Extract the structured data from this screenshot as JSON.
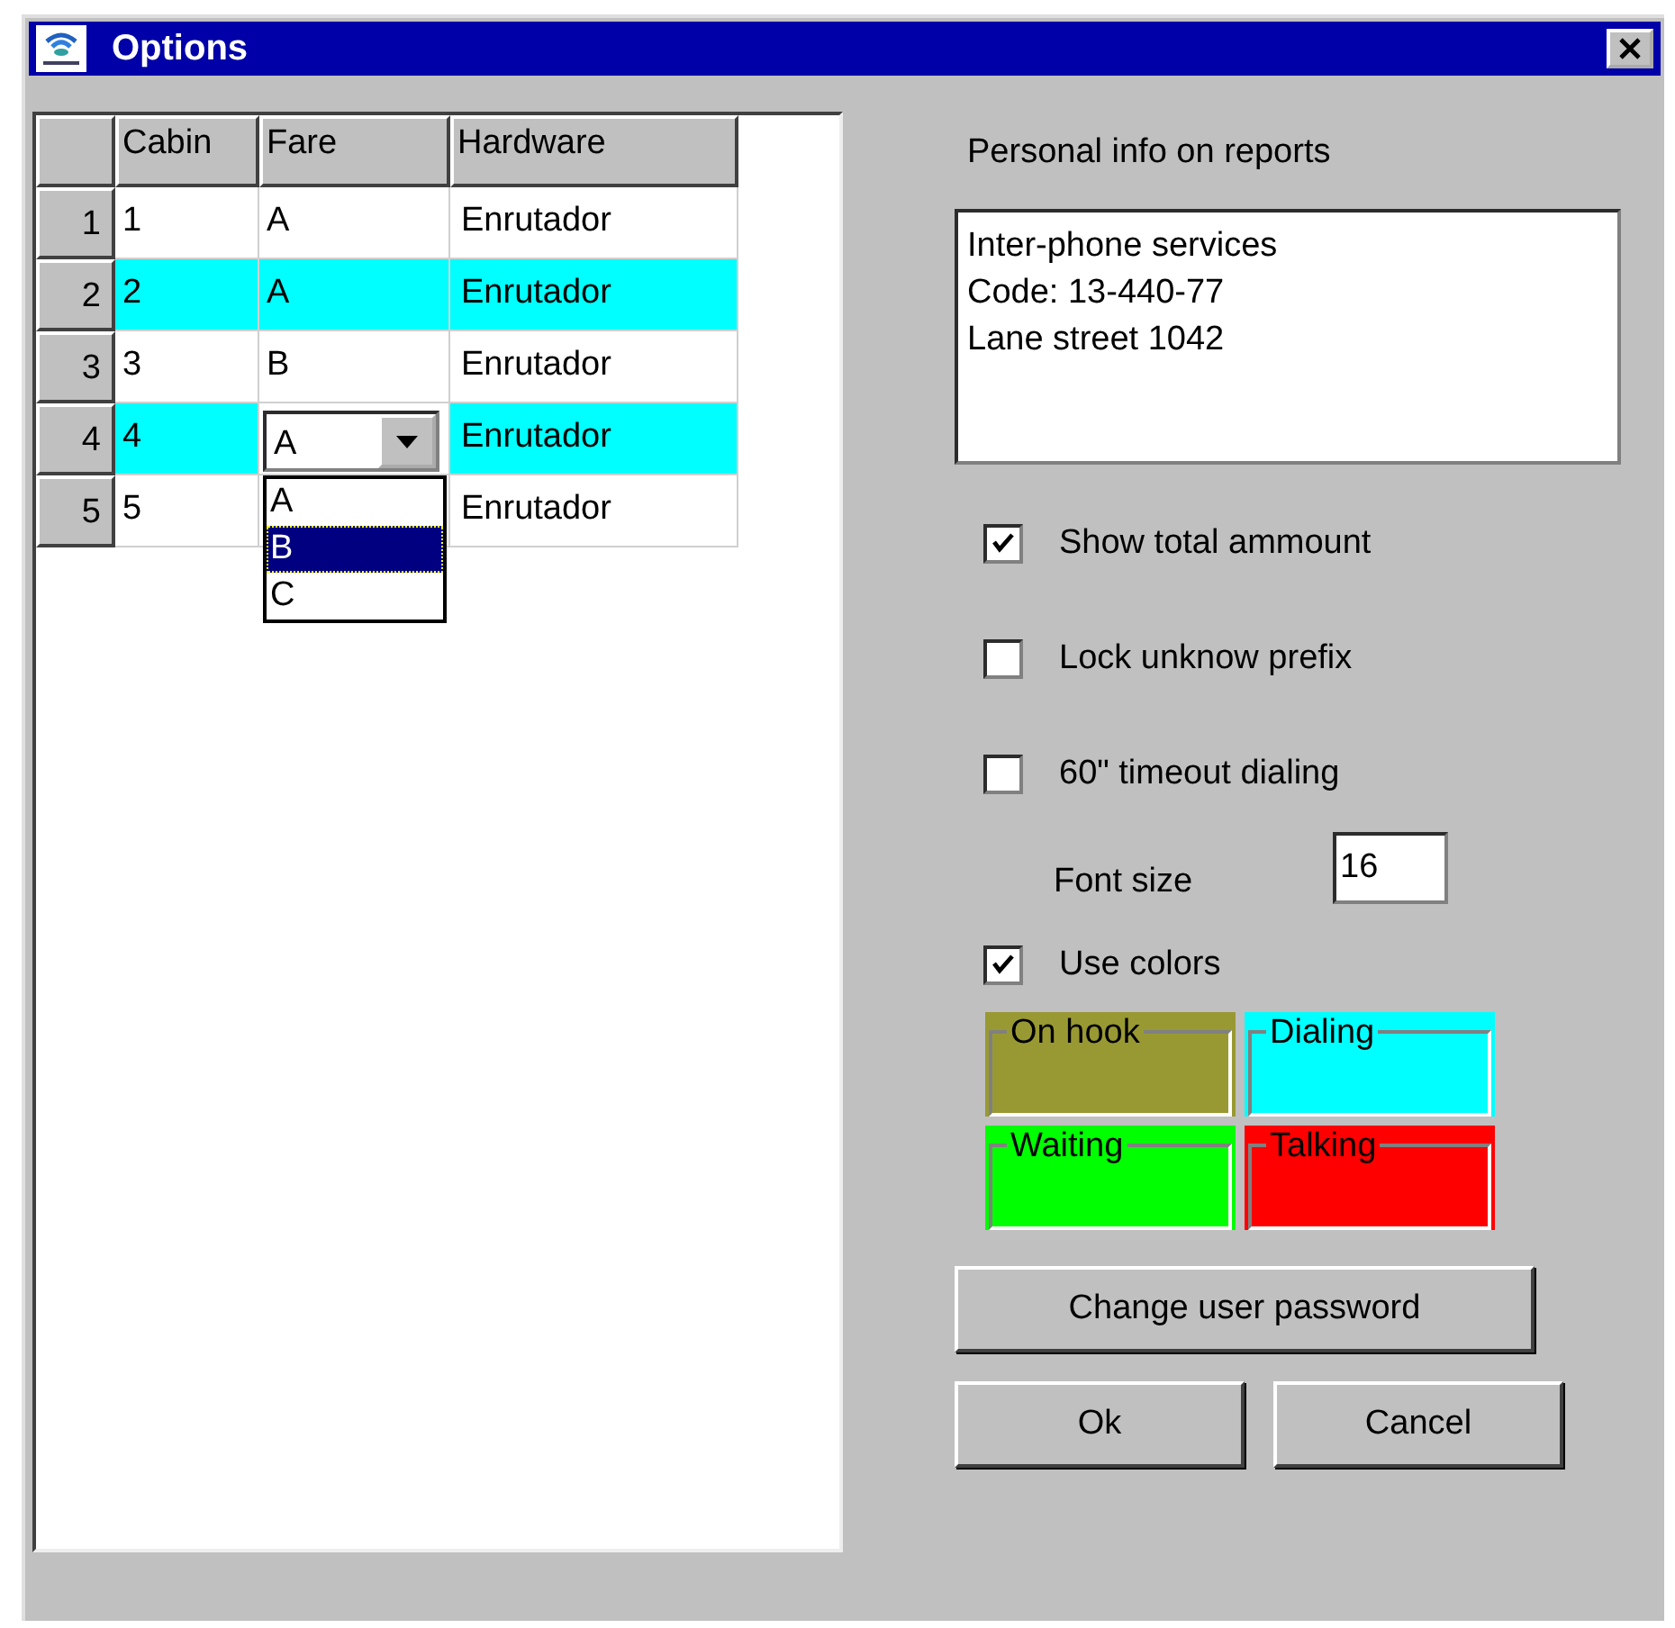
{
  "window": {
    "title": "Options"
  },
  "grid": {
    "columns": [
      "Cabin",
      "Fare",
      "Hardware"
    ],
    "rows": [
      {
        "number": "1",
        "cabin": "1",
        "fare": "A",
        "hardware": "Enrutador",
        "highlighted": false
      },
      {
        "number": "2",
        "cabin": "2",
        "fare": "A",
        "hardware": "Enrutador",
        "highlighted": true
      },
      {
        "number": "3",
        "cabin": "3",
        "fare": "B",
        "hardware": "Enrutador",
        "highlighted": false
      },
      {
        "number": "4",
        "cabin": "4",
        "fare": "A",
        "hardware": "Enrutador",
        "highlighted": true,
        "fare_dropdown": {
          "expanded": true,
          "options": [
            {
              "label": "A",
              "selected": false
            },
            {
              "label": "B",
              "selected": true
            },
            {
              "label": "C",
              "selected": false
            }
          ]
        }
      },
      {
        "number": "5",
        "cabin": "5",
        "hardware": "Enrutador",
        "highlighted": false
      }
    ]
  },
  "personal_info": {
    "label": "Personal info on reports",
    "lines": [
      "Inter-phone services",
      "Code: 13-440-77",
      "Lane street 1042"
    ]
  },
  "checkboxes": [
    {
      "label": "Show total ammount",
      "checked": true
    },
    {
      "label": "Lock unknow prefix",
      "checked": false
    },
    {
      "label": "60\" timeout dialing",
      "checked": false
    }
  ],
  "font_size": {
    "label": "Font size",
    "value": "16"
  },
  "use_colors": {
    "label": "Use colors",
    "checked": true
  },
  "color_legend": [
    {
      "label": "On hook",
      "color": "#999933"
    },
    {
      "label": "Dialing",
      "color": "#00ffff"
    },
    {
      "label": "Waiting",
      "color": "#00ff00"
    },
    {
      "label": "Talking",
      "color": "#ff0000"
    }
  ],
  "buttons": {
    "change_password": "Change user password",
    "ok": "Ok",
    "cancel": "Cancel"
  }
}
